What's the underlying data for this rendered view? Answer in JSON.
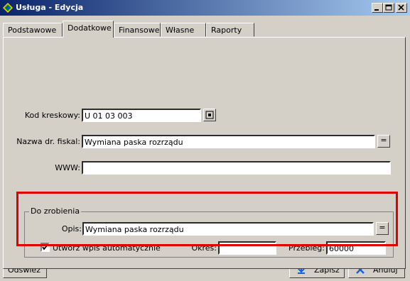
{
  "window": {
    "title": "Usługa - Edycja"
  },
  "tabs": [
    {
      "label": "Podstawowe"
    },
    {
      "label": "Dodatkowe"
    },
    {
      "label": "Finansowe"
    },
    {
      "label": "Własne"
    },
    {
      "label": "Raporty"
    }
  ],
  "fields": {
    "kod": {
      "label": "Kod kreskowy:",
      "value": "U 01 03 003"
    },
    "nazwa": {
      "label": "Nazwa dr. fiskal:",
      "value": "Wymiana paska rozrządu"
    },
    "www": {
      "label": "WWW:",
      "value": ""
    }
  },
  "do_zrobienia": {
    "title": "Do zrobienia",
    "opis_label": "Opis:",
    "opis_value": "Wymiana paska rozrządu",
    "checkbox_label": "Utwórz wpis automatycznie",
    "checkbox_checked": true,
    "okres_label": "Okres:",
    "okres_value": "",
    "przebieg_label": "Przebieg:",
    "przebieg_value": "60000"
  },
  "buttons": {
    "ellipsis": "=",
    "odswiez": "Odśwież",
    "zapisz": "Zapisz",
    "anuluj": "Anuluj"
  },
  "colors": {
    "title_gradient_start": "#0a246a",
    "title_gradient_end": "#a6caf0",
    "highlight": "#e00000"
  }
}
